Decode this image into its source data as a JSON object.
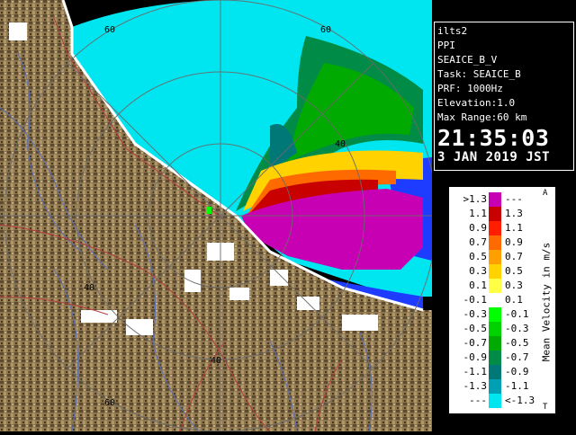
{
  "info": {
    "site": "ilts2",
    "product": "PPI",
    "scan": "SEAICE_B_V",
    "task": "Task: SEAICE_B",
    "prf": "PRF: 1000Hz",
    "elevation": "Elevation:1.0",
    "max_range": "Max Range:60 km",
    "time": "21:35:03",
    "date": "3 JAN 2019 JST"
  },
  "range_labels": {
    "top_left": "60",
    "ring_top_center": "60",
    "ring_40_right": "40",
    "ring_40_left": "40",
    "ring_40_bottom": "40",
    "ring_60_bottom": "60"
  },
  "legend": {
    "title": "Mean Velocity in m/s",
    "top_marker": "A",
    "bottom_marker": "T",
    "rows": [
      {
        "lo": ">1.3",
        "hi": "---",
        "color": "#c800b4"
      },
      {
        "lo": "1.1",
        "hi": "1.3",
        "color": "#c80000"
      },
      {
        "lo": "0.9",
        "hi": "1.1",
        "color": "#ff1e00"
      },
      {
        "lo": "0.7",
        "hi": "0.9",
        "color": "#ff6a00"
      },
      {
        "lo": "0.5",
        "hi": "0.7",
        "color": "#ffa000"
      },
      {
        "lo": "0.3",
        "hi": "0.5",
        "color": "#ffd200"
      },
      {
        "lo": "0.1",
        "hi": "0.3",
        "color": "#ffff46"
      },
      {
        "lo": "-0.1",
        "hi": "0.1",
        "color": "#ffffff"
      },
      {
        "lo": "-0.3",
        "hi": "-0.1",
        "color": "#00ff00"
      },
      {
        "lo": "-0.5",
        "hi": "-0.3",
        "color": "#00d200"
      },
      {
        "lo": "-0.7",
        "hi": "-0.5",
        "color": "#00aa00"
      },
      {
        "lo": "-0.9",
        "hi": "-0.7",
        "color": "#008c46"
      },
      {
        "lo": "-1.1",
        "hi": "-0.9",
        "color": "#007878"
      },
      {
        "lo": "-1.3",
        "hi": "-1.1",
        "color": "#00a0b4"
      },
      {
        "lo": "---",
        "hi": "<-1.3",
        "color": "#00e6f0"
      }
    ]
  },
  "colors": {
    "sea": "#00e6f0",
    "terrain": "#8c7650",
    "coast": "#ffffff",
    "rivers": "#5a6eb4",
    "roads": "#b43c3c"
  }
}
